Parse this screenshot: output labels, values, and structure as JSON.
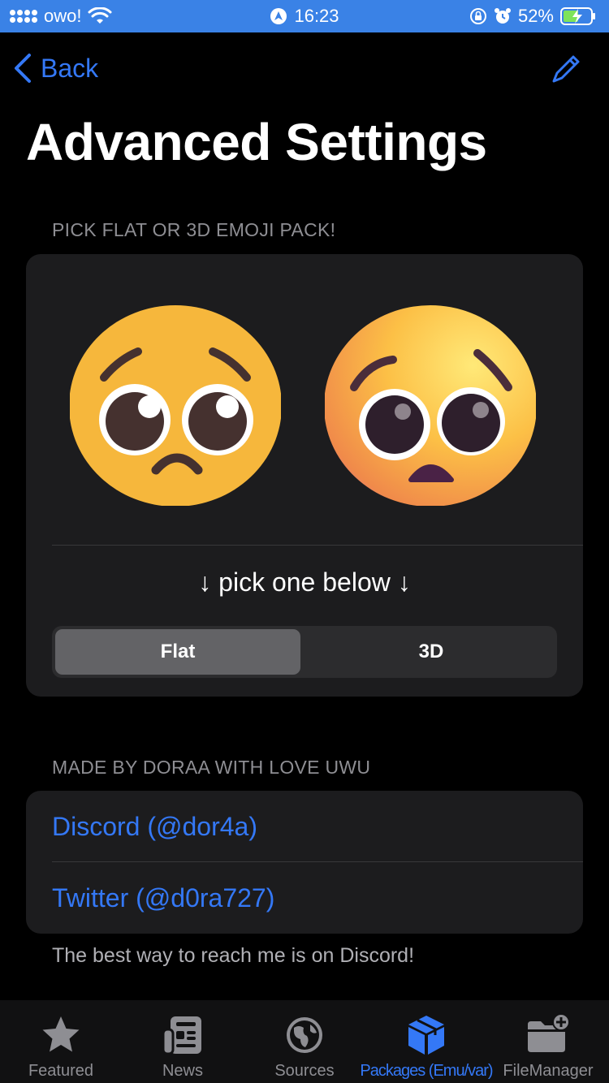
{
  "status_bar": {
    "carrier": "owo!",
    "time": "16:23",
    "battery": "52%",
    "background": "#3a82e6"
  },
  "nav": {
    "back_label": "Back",
    "title": "Advanced Settings"
  },
  "emoji_section": {
    "header": "PICK FLAT OR 3D EMOJI PACK!",
    "hint": "↓ pick one below ↓",
    "options": [
      {
        "label": "Flat",
        "selected": true
      },
      {
        "label": "3D",
        "selected": false
      }
    ]
  },
  "credits_section": {
    "header": "MADE BY DORAA WITH LOVE UWU",
    "links": [
      {
        "label": "Discord (@dor4a)"
      },
      {
        "label": "Twitter (@d0ra727)"
      }
    ],
    "footer": "The best way to reach me is on Discord!"
  },
  "tab_bar": {
    "tabs": [
      {
        "label": "Featured",
        "icon": "star-icon",
        "active": false
      },
      {
        "label": "News",
        "icon": "newspaper-icon",
        "active": false
      },
      {
        "label": "Sources",
        "icon": "globe-icon",
        "active": false
      },
      {
        "label": "Packages (Emu/var)",
        "icon": "package-box-icon",
        "active": true
      },
      {
        "label": "FileManager",
        "icon": "folder-plus-icon",
        "active": false
      }
    ]
  },
  "colors": {
    "accent": "#3478f6",
    "card": "#1c1c1e",
    "background": "#000000"
  }
}
